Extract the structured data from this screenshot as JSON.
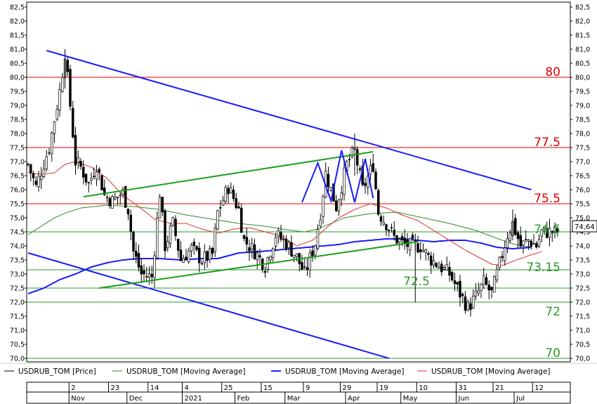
{
  "chart_data": {
    "type": "line",
    "title": "",
    "y_range": [
      70.0,
      82.5
    ],
    "y_ticks": [
      70.0,
      70.5,
      71.0,
      71.5,
      72.0,
      72.5,
      73.0,
      73.5,
      74.0,
      74.5,
      75.0,
      75.5,
      76.0,
      76.5,
      77.0,
      77.5,
      78.0,
      78.5,
      79.0,
      79.5,
      80.0,
      80.5,
      81.0,
      81.5,
      82.0,
      82.5
    ],
    "last_price_label": "74,64",
    "last_price": 74.64,
    "x_ticks": [
      {
        "label": "2",
        "i": 15
      },
      {
        "label": "23",
        "i": 30
      },
      {
        "label": "14",
        "i": 45
      },
      {
        "label": "4",
        "i": 58
      },
      {
        "label": "25",
        "i": 73
      },
      {
        "label": "15",
        "i": 88
      },
      {
        "label": "9",
        "i": 104
      },
      {
        "label": "29",
        "i": 118
      },
      {
        "label": "19",
        "i": 132
      },
      {
        "label": "10",
        "i": 147
      },
      {
        "label": "31",
        "i": 162
      },
      {
        "label": "21",
        "i": 176
      },
      {
        "label": "12",
        "i": 191
      }
    ],
    "month_labels": [
      {
        "label": "Nov",
        "i": 15
      },
      {
        "label": "Dec",
        "i": 37
      },
      {
        "label": "2021",
        "i": 58
      },
      {
        "label": "Feb",
        "i": 78
      },
      {
        "label": "Mar",
        "i": 97
      },
      {
        "label": "Apr",
        "i": 120
      },
      {
        "label": "May",
        "i": 141
      },
      {
        "label": "Jun",
        "i": 162
      },
      {
        "label": "Jul",
        "i": 184
      }
    ],
    "n_bars": 202,
    "close_anchors": [
      [
        0,
        76.9
      ],
      [
        3,
        76.1
      ],
      [
        8,
        77.5
      ],
      [
        12,
        79.5
      ],
      [
        14,
        80.9
      ],
      [
        16,
        79.0
      ],
      [
        18,
        77.0
      ],
      [
        20,
        76.8
      ],
      [
        23,
        76.2
      ],
      [
        26,
        76.9
      ],
      [
        29,
        75.8
      ],
      [
        32,
        75.6
      ],
      [
        36,
        75.9
      ],
      [
        38,
        75.3
      ],
      [
        40,
        73.8
      ],
      [
        43,
        73.0
      ],
      [
        47,
        72.9
      ],
      [
        50,
        75.9
      ],
      [
        52,
        74.0
      ],
      [
        55,
        74.8
      ],
      [
        58,
        73.5
      ],
      [
        62,
        73.9
      ],
      [
        66,
        73.5
      ],
      [
        70,
        73.7
      ],
      [
        72,
        75.2
      ],
      [
        76,
        76.1
      ],
      [
        80,
        75.3
      ],
      [
        82,
        74.2
      ],
      [
        86,
        73.8
      ],
      [
        90,
        73.3
      ],
      [
        94,
        74.4
      ],
      [
        98,
        74.1
      ],
      [
        102,
        73.6
      ],
      [
        105,
        73.0
      ],
      [
        109,
        74.1
      ],
      [
        111,
        75.2
      ],
      [
        113,
        76.6
      ],
      [
        117,
        75.4
      ],
      [
        121,
        76.9
      ],
      [
        124,
        77.4
      ],
      [
        127,
        76.0
      ],
      [
        131,
        76.9
      ],
      [
        133,
        75.2
      ],
      [
        136,
        74.8
      ],
      [
        139,
        74.3
      ],
      [
        142,
        74.1
      ],
      [
        145,
        74.0
      ],
      [
        149,
        74.0
      ],
      [
        152,
        73.6
      ],
      [
        156,
        73.3
      ],
      [
        160,
        73.0
      ],
      [
        164,
        72.3
      ],
      [
        167,
        71.8
      ],
      [
        170,
        72.2
      ],
      [
        173,
        72.7
      ],
      [
        176,
        72.3
      ],
      [
        178,
        73.0
      ],
      [
        180,
        73.7
      ],
      [
        182,
        74.4
      ],
      [
        184,
        74.8
      ],
      [
        187,
        74.0
      ],
      [
        190,
        74.2
      ],
      [
        193,
        74.0
      ],
      [
        195,
        74.5
      ]
    ],
    "lines": [
      {
        "name": "resistance",
        "color": "#1a1aff",
        "points": [
          [
            7,
            80.95
          ],
          [
            191,
            76.0
          ]
        ]
      },
      {
        "name": "support",
        "color": "#1a1aff",
        "points": [
          [
            0,
            73.75
          ],
          [
            137,
            70.0
          ]
        ]
      },
      {
        "name": "channel-upper",
        "color": "#1b9e1b",
        "points": [
          [
            21,
            75.75
          ],
          [
            131,
            77.35
          ]
        ]
      },
      {
        "name": "channel-lower",
        "color": "#1b9e1b",
        "points": [
          [
            27,
            72.5
          ],
          [
            148,
            74.15
          ]
        ]
      },
      {
        "name": "pattern",
        "color": "#1a1aff",
        "points": [
          [
            104,
            75.55
          ],
          [
            110,
            76.95
          ],
          [
            115,
            75.6
          ],
          [
            119,
            77.4
          ],
          [
            124,
            75.55
          ],
          [
            128,
            77.1
          ],
          [
            131,
            75.7
          ]
        ]
      }
    ],
    "levels": [
      {
        "value": 80.0,
        "label": "80",
        "color": "#dd0000"
      },
      {
        "value": 77.5,
        "label": "77.5",
        "color": "#dd0000"
      },
      {
        "value": 75.5,
        "label": "75.5",
        "color": "#dd0000"
      },
      {
        "value": 74.5,
        "label": "74.5",
        "color": "#2a9a2a"
      },
      {
        "value": 73.15,
        "label": "73.15",
        "color": "#2a9a2a"
      },
      {
        "value": 72.5,
        "label": "72.5",
        "color": "#2a9a2a"
      },
      {
        "value": 72.0,
        "label": "72",
        "color": "#2a9a2a"
      },
      {
        "value": 70.0,
        "label": "70",
        "color": "#2a9a2a"
      }
    ],
    "ma": [
      {
        "color": "#2e8b2e",
        "width": 1,
        "anchors": [
          [
            0,
            74.4
          ],
          [
            5,
            74.7
          ],
          [
            10,
            75.0
          ],
          [
            15,
            75.2
          ],
          [
            20,
            75.35
          ],
          [
            30,
            75.45
          ],
          [
            40,
            75.4
          ],
          [
            50,
            75.3
          ],
          [
            60,
            75.1
          ],
          [
            70,
            74.95
          ],
          [
            80,
            74.8
          ],
          [
            90,
            74.7
          ],
          [
            100,
            74.55
          ],
          [
            105,
            74.5
          ],
          [
            110,
            74.6
          ],
          [
            115,
            74.8
          ],
          [
            120,
            75.0
          ],
          [
            130,
            75.15
          ],
          [
            140,
            75.2
          ],
          [
            150,
            75.0
          ],
          [
            160,
            74.8
          ],
          [
            170,
            74.55
          ],
          [
            180,
            74.2
          ],
          [
            185,
            74.05
          ],
          [
            191,
            73.95
          ]
        ]
      },
      {
        "color": "#1a1aff",
        "width": 2,
        "anchors": [
          [
            0,
            72.3
          ],
          [
            6,
            72.5
          ],
          [
            12,
            72.8
          ],
          [
            18,
            73.0
          ],
          [
            24,
            73.25
          ],
          [
            30,
            73.4
          ],
          [
            36,
            73.5
          ],
          [
            42,
            73.55
          ],
          [
            50,
            73.55
          ],
          [
            58,
            73.5
          ],
          [
            66,
            73.55
          ],
          [
            72,
            73.55
          ],
          [
            80,
            73.75
          ],
          [
            88,
            73.8
          ],
          [
            94,
            73.85
          ],
          [
            100,
            73.9
          ],
          [
            106,
            73.95
          ],
          [
            112,
            74.0
          ],
          [
            118,
            74.05
          ],
          [
            124,
            74.15
          ],
          [
            130,
            74.2
          ],
          [
            136,
            74.25
          ],
          [
            142,
            74.25
          ],
          [
            148,
            74.2
          ],
          [
            154,
            74.15
          ],
          [
            160,
            74.2
          ],
          [
            166,
            74.2
          ],
          [
            172,
            74.1
          ],
          [
            178,
            73.95
          ],
          [
            184,
            73.9
          ],
          [
            191,
            73.95
          ]
        ]
      },
      {
        "color": "#e03030",
        "width": 1,
        "anchors": [
          [
            0,
            76.6
          ],
          [
            5,
            76.55
          ],
          [
            10,
            76.6
          ],
          [
            14,
            76.9
          ],
          [
            18,
            77.0
          ],
          [
            24,
            76.8
          ],
          [
            30,
            76.4
          ],
          [
            36,
            75.8
          ],
          [
            42,
            75.4
          ],
          [
            48,
            74.95
          ],
          [
            54,
            74.8
          ],
          [
            60,
            74.8
          ],
          [
            66,
            74.6
          ],
          [
            72,
            74.45
          ],
          [
            78,
            74.6
          ],
          [
            84,
            74.65
          ],
          [
            90,
            74.5
          ],
          [
            96,
            74.35
          ],
          [
            102,
            74.0
          ],
          [
            108,
            74.2
          ],
          [
            114,
            74.7
          ],
          [
            118,
            75.0
          ],
          [
            124,
            75.3
          ],
          [
            130,
            75.5
          ],
          [
            136,
            75.35
          ],
          [
            142,
            75.1
          ],
          [
            148,
            74.9
          ],
          [
            154,
            74.55
          ],
          [
            160,
            74.2
          ],
          [
            166,
            73.85
          ],
          [
            172,
            73.55
          ],
          [
            176,
            73.35
          ],
          [
            180,
            73.3
          ],
          [
            184,
            73.45
          ],
          [
            190,
            73.65
          ],
          [
            195,
            73.8
          ]
        ]
      }
    ],
    "legend": [
      {
        "label": "USDRUB_TOM [Price]",
        "color": "#000000"
      },
      {
        "label": "USDRUB_TOM [Moving Average]",
        "color": "#2e8b2e"
      },
      {
        "label": "USDRUB_TOM [Moving Average]",
        "color": "#1a1aff"
      },
      {
        "label": "USDRUB_TOM [Moving Average]",
        "color": "#e03030"
      }
    ]
  }
}
